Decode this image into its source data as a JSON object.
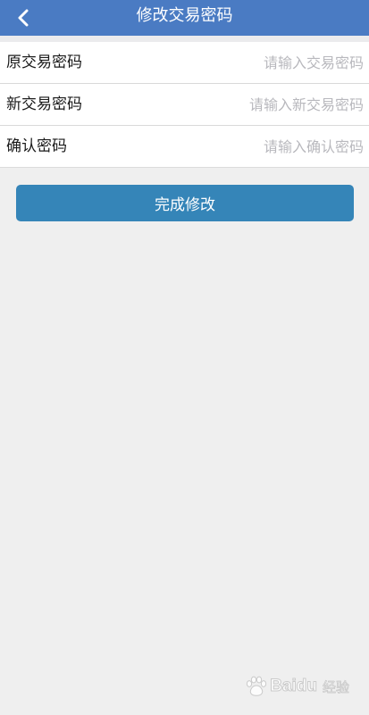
{
  "header": {
    "title": "修改交易密码",
    "back_icon": "chevron-left-icon",
    "background_color": "#4a7bc3"
  },
  "form": {
    "fields": [
      {
        "label": "原交易密码",
        "placeholder": "请输入交易密码",
        "value": ""
      },
      {
        "label": "新交易密码",
        "placeholder": "请输入新交易密码",
        "value": ""
      },
      {
        "label": "确认密码",
        "placeholder": "请输入确认密码",
        "value": ""
      }
    ]
  },
  "submit": {
    "label": "完成修改",
    "color": "#3585b8"
  },
  "watermark": {
    "brand": "Baidu",
    "suffix": "经验"
  }
}
